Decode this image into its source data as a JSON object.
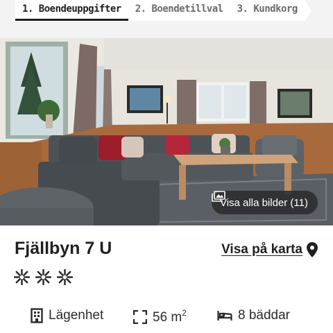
{
  "stepper": {
    "steps": [
      {
        "label": "1. Boendeuppgifter",
        "active": true
      },
      {
        "label": "2. Boendetillval",
        "active": false
      },
      {
        "label": "3. Kundkorg",
        "active": false
      }
    ]
  },
  "hero": {
    "gallery_button": "Visa alla bilder (11)"
  },
  "property": {
    "title": "Fjällbyn 7 U",
    "map_link": "Visa på karta",
    "rating_icons": [
      "snowflake-icon",
      "snowflake-icon",
      "snowflake-icon"
    ]
  },
  "facts": {
    "type": "Lägenhet",
    "area_value": "56 m",
    "area_unit_sup": "2",
    "beds": "8 bäddar"
  }
}
